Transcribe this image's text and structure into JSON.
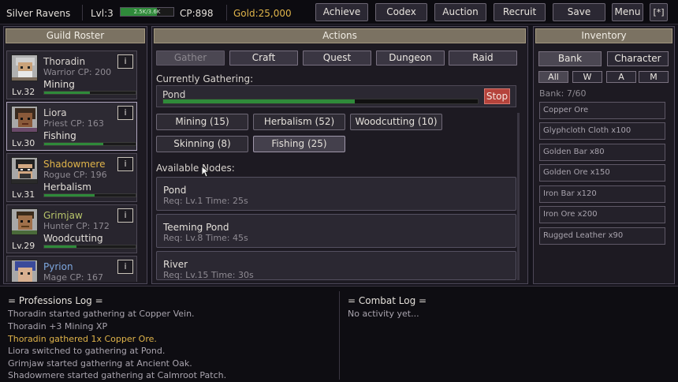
{
  "topbar": {
    "guild_name": "Silver Ravens",
    "level": "Lvl:3",
    "xp_text": "2.5K/3.6K",
    "xp_progress": 0.69,
    "cp": "CP:898",
    "gold": "Gold:25,000",
    "buttons": [
      "Achieve",
      "Codex",
      "Auction",
      "Recruit",
      "Save",
      "Menu",
      "[*]"
    ]
  },
  "roster": {
    "title": "Guild Roster",
    "members": [
      {
        "name": "Thoradin",
        "class_cp": "Warrior  CP: 200",
        "profession": "Mining",
        "level": "Lv.32",
        "progress": 0.5,
        "name_color": "#d9d4cf"
      },
      {
        "name": "Liora",
        "class_cp": "Priest  CP: 163",
        "profession": "Fishing",
        "level": "Lv.30",
        "progress": 0.65,
        "name_color": "#d9d4cf"
      },
      {
        "name": "Shadowmere",
        "class_cp": "Rogue  CP: 196",
        "profession": "Herbalism",
        "level": "Lv.31",
        "progress": 0.55,
        "name_color": "#e0b44a"
      },
      {
        "name": "Grimjaw",
        "class_cp": "Hunter  CP: 172",
        "profession": "Woodcutting",
        "level": "Lv.29",
        "progress": 0.35,
        "name_color": "#b7c46a"
      },
      {
        "name": "Pyrion",
        "class_cp": "Mage  CP: 167",
        "profession": "",
        "level": "",
        "progress": 0,
        "name_color": "#7ea8e0"
      }
    ],
    "info_label": "i"
  },
  "actions": {
    "title": "Actions",
    "tabs": [
      "Gather",
      "Craft",
      "Quest",
      "Dungeon",
      "Raid"
    ],
    "currently_label": "Currently Gathering:",
    "current_node": "Pond",
    "current_progress": 0.61,
    "stop_label": "Stop",
    "skills": [
      "Mining (15)",
      "Herbalism (52)",
      "Woodcutting (10)",
      "Skinning (8)",
      "Fishing (25)"
    ],
    "nodes_label": "Available Nodes:",
    "nodes": [
      {
        "name": "Pond",
        "req": "Req: Lv.1   Time: 25s"
      },
      {
        "name": "Teeming Pond",
        "req": "Req: Lv.8   Time: 45s"
      },
      {
        "name": "River",
        "req": "Req: Lv.15   Time: 30s"
      }
    ]
  },
  "inventory": {
    "title": "Inventory",
    "bank_label": "Bank",
    "character_label": "Character",
    "filters": [
      "All",
      "W",
      "A",
      "M"
    ],
    "bank_count": "Bank: 7/60",
    "items": [
      "Copper Ore",
      "Glyphcloth Cloth x100",
      "Golden Bar x80",
      "Golden Ore x150",
      "Iron Bar x120",
      "Iron Ore x200",
      "Rugged Leather x90"
    ]
  },
  "logs": {
    "professions_title": "= Professions Log =",
    "professions": [
      "Thoradin started gathering at Copper Vein.",
      "Thoradin +3 Mining XP",
      "Thoradin gathered 1x Copper Ore.",
      "Liora switched to gathering at Pond.",
      "Grimjaw started gathering at Ancient Oak.",
      "Shadowmere started gathering at Calmroot Patch."
    ],
    "highlight_index": 2,
    "combat_title": "= Combat Log =",
    "combat_text": "No activity yet..."
  },
  "colors": {
    "accent_green": "#2f8a3a",
    "gold_text": "#e0b44a",
    "stop_red": "#b5433b",
    "header_tan": "#7b7262"
  }
}
